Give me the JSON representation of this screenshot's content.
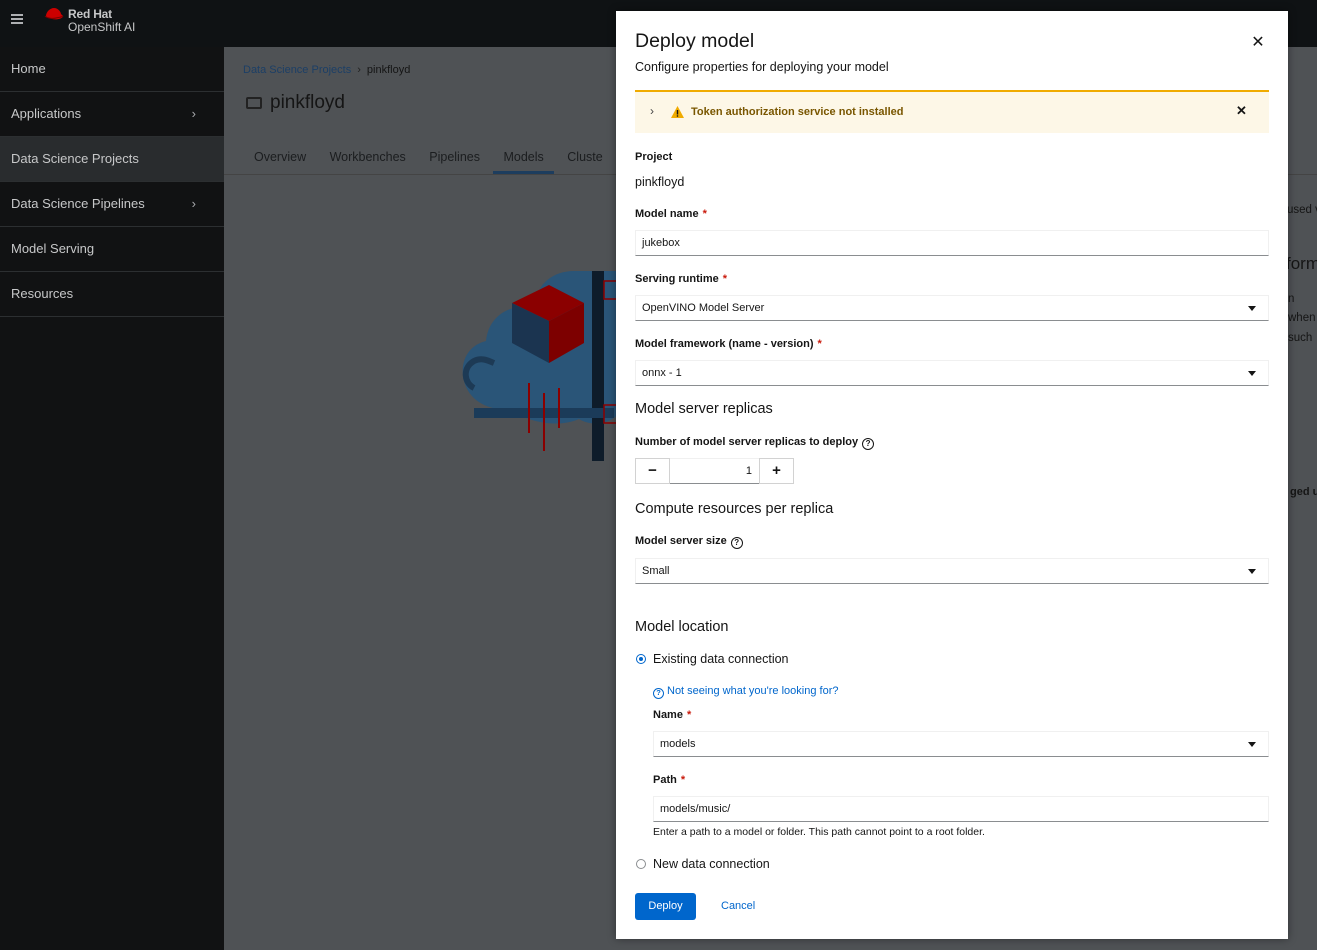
{
  "masthead": {
    "brand_line1": "Red Hat",
    "brand_line2": "OpenShift AI"
  },
  "sidebar": {
    "items": [
      {
        "label": "Home",
        "has_chevron": false
      },
      {
        "label": "Applications",
        "has_chevron": true
      },
      {
        "label": "Data Science Projects",
        "has_chevron": false,
        "active": true
      },
      {
        "label": "Data Science Pipelines",
        "has_chevron": true
      },
      {
        "label": "Model Serving",
        "has_chevron": false
      },
      {
        "label": "Resources",
        "has_chevron": false
      }
    ]
  },
  "main": {
    "breadcrumb": {
      "parent": "Data Science Projects",
      "current": "pinkfloyd"
    },
    "title": "pinkfloyd",
    "tabs": [
      "Overview",
      "Workbenches",
      "Pipelines",
      "Models",
      "Cluste"
    ],
    "active_tab": "Models",
    "fragments": {
      "used": "used v",
      "form": "form",
      "n": "n",
      "when": "when",
      "such": "such",
      "aged": "ged ur"
    }
  },
  "modal": {
    "title": "Deploy model",
    "subtitle": "Configure properties for deploying your model",
    "alert": {
      "text": "Token authorization service not installed"
    },
    "project": {
      "label": "Project",
      "value": "pinkfloyd"
    },
    "model_name": {
      "label": "Model name",
      "value": "jukebox"
    },
    "serving_runtime": {
      "label": "Serving runtime",
      "value": "OpenVINO Model Server"
    },
    "model_framework": {
      "label": "Model framework (name - version)",
      "value": "onnx - 1"
    },
    "replicas": {
      "heading": "Model server replicas",
      "label": "Number of model server replicas to deploy",
      "value": "1",
      "minus": "−",
      "plus": "+"
    },
    "compute": {
      "heading": "Compute resources per replica",
      "label": "Model server size",
      "value": "Small"
    },
    "location": {
      "heading": "Model location",
      "existing_label": "Existing data connection",
      "help_link": "Not seeing what you're looking for?",
      "name_label": "Name",
      "name_value": "models",
      "path_label": "Path",
      "path_value": "models/music/",
      "path_hint": "Enter a path to a model or folder. This path cannot point to a root folder.",
      "new_label": "New data connection",
      "selected": "existing"
    },
    "actions": {
      "deploy": "Deploy",
      "cancel": "Cancel"
    }
  },
  "colors": {
    "primary": "#0066cc",
    "required": "#c9190b",
    "warning": "#f0ab00",
    "masthead": "#0f1214",
    "overlay": "#4f5255"
  }
}
